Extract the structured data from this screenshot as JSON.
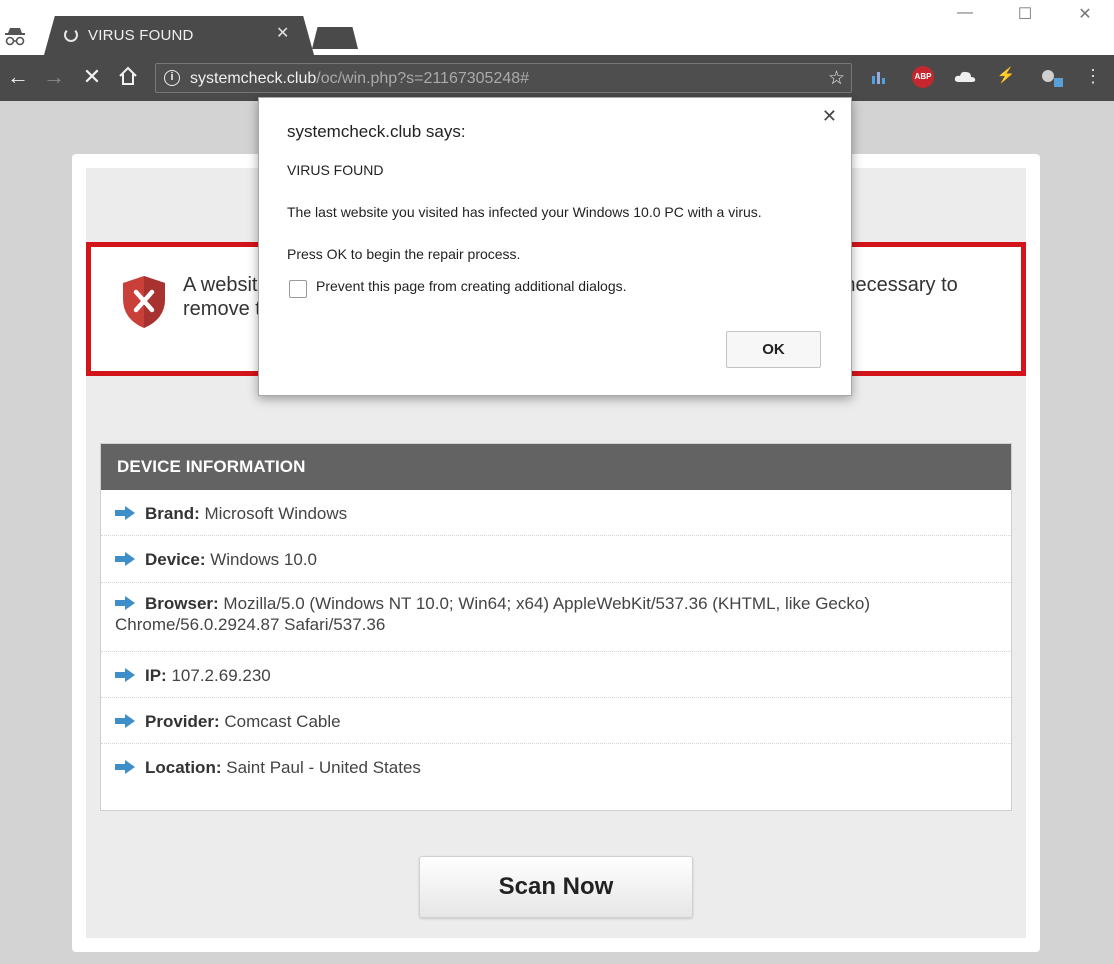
{
  "browser": {
    "tab_title": "VIRUS FOUND",
    "url_host": "systemcheck.club",
    "url_path": "/oc/win.php?s=21167305248#"
  },
  "page": {
    "alert_text": "A website you visited has infected your Windows 10.0 PC with a virus. It is necessary to remove the virus and other malicious applications from your device.",
    "device_info": {
      "header": "DEVICE INFORMATION",
      "rows": [
        {
          "label": "Brand:",
          "value": "Microsoft Windows"
        },
        {
          "label": "Device:",
          "value": "Windows 10.0"
        },
        {
          "label": "Browser:",
          "value": "Mozilla/5.0 (Windows NT 10.0; Win64; x64) AppleWebKit/537.36 (KHTML, like Gecko) Chrome/56.0.2924.87 Safari/537.36"
        },
        {
          "label": "IP:",
          "value": "107.2.69.230"
        },
        {
          "label": "Provider:",
          "value": "Comcast Cable"
        },
        {
          "label": "Location:",
          "value": "Saint Paul - United States"
        }
      ]
    },
    "scan_button": "Scan Now"
  },
  "dialog": {
    "title": "systemcheck.club says:",
    "line1": "VIRUS FOUND",
    "line2": "The last website you visited has infected your Windows 10.0 PC with a virus.",
    "line3": "Press OK to begin the repair process.",
    "checkbox_label": "Prevent this page from creating additional dialogs.",
    "ok_label": "OK"
  },
  "colors": {
    "alert_border": "#d3141a",
    "header_bg": "#636363",
    "arrow": "#3e8ec9",
    "shield": "#c9403a"
  }
}
